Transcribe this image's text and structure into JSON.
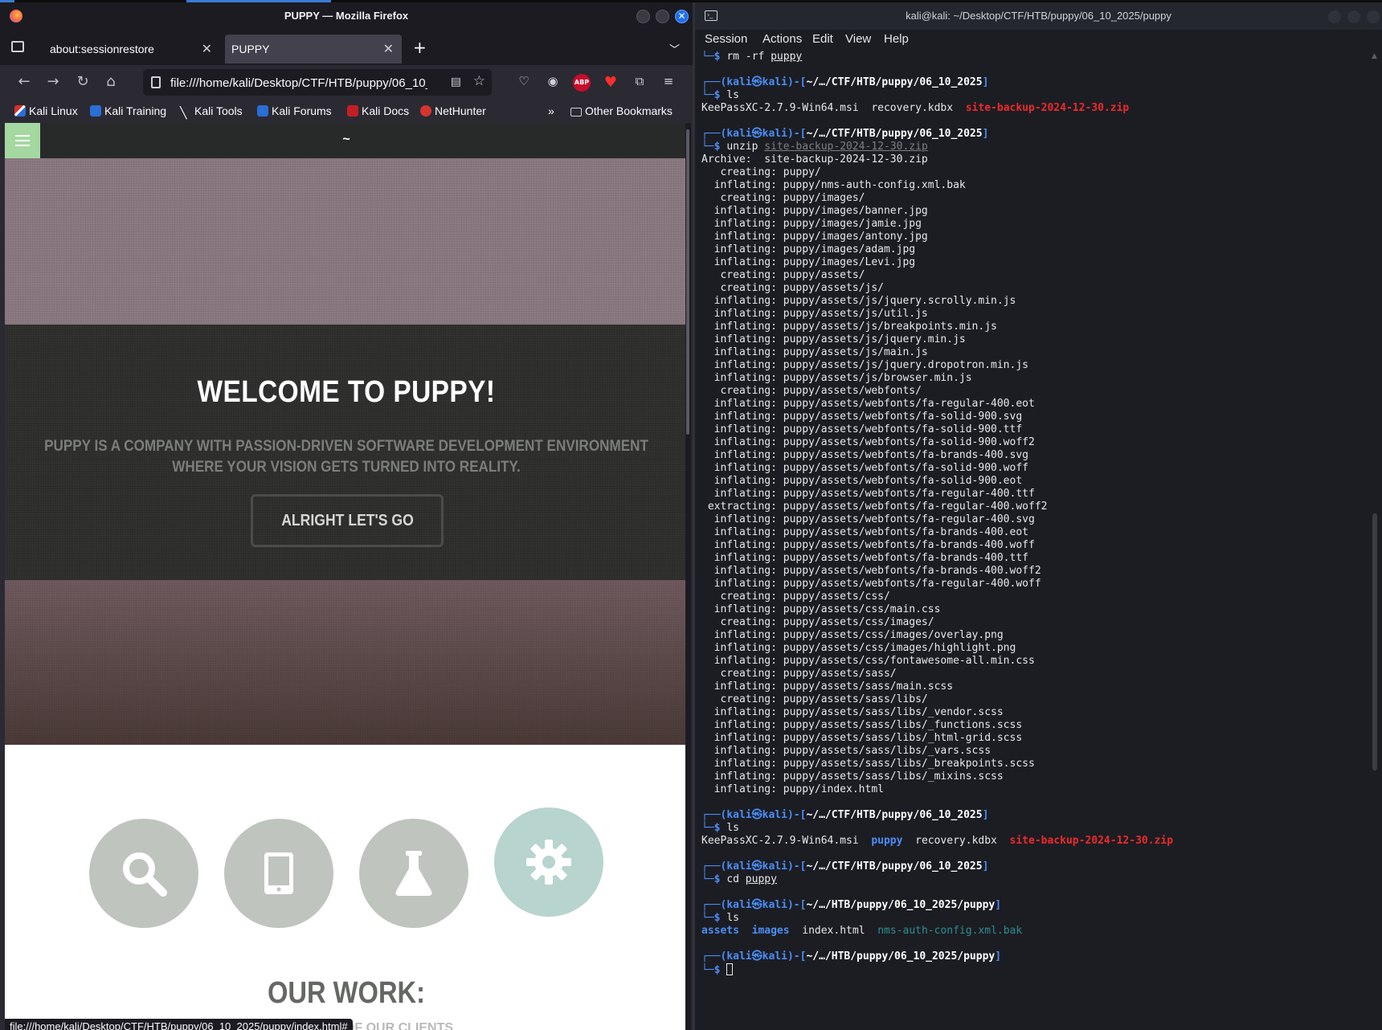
{
  "firefox": {
    "window_title": "PUPPY — Mozilla Firefox",
    "tabs": [
      {
        "label": "about:sessionrestore",
        "active": false
      },
      {
        "label": "PUPPY",
        "active": true
      }
    ],
    "url": "file:///home/kali/Desktop/CTF/HTB/puppy/06_10_2025/puppy/index.html",
    "bookmarks": [
      "Kali Linux",
      "Kali Training",
      "Kali Tools",
      "Kali Forums",
      "Kali Docs",
      "NetHunter"
    ],
    "other_bookmarks": "Other Bookmarks",
    "status_url": "file:///home/kali/Desktop/CTF/HTB/puppy/06_10_2025/puppy/index.html#"
  },
  "page": {
    "header_text": "~",
    "welcome": "WELCOME TO PUPPY!",
    "tagline": "PUPPY IS A COMPANY WITH PASSION-DRIVEN SOFTWARE DEVELOPMENT ENVIRONMENT WHERE YOUR VISION GETS TURNED INTO REALITY.",
    "cta": "ALRIGHT LET'S GO",
    "feature_icons": [
      "search-icon",
      "tablet-icon",
      "flask-icon",
      "gear-icon"
    ],
    "our_work": "OUR WORK:",
    "work_sub": "ID AND BUDGET OF OUR CLIENTS"
  },
  "terminal": {
    "window_title": "kali@kali: ~/Desktop/CTF/HTB/puppy/06_10_2025/puppy",
    "menu": [
      "Session",
      "Actions",
      "Edit",
      "View",
      "Help"
    ],
    "prompt": {
      "user": "kali",
      "at": "㉿",
      "host": "kali",
      "path1": "~/…/CTF/HTB/puppy/06_10_2025",
      "path2": "~/…/HTB/puppy/06_10_2025/puppy"
    },
    "cmd_rm": "rm -rf",
    "cmd_rm_arg": "puppy",
    "cmd_ls": "ls",
    "cmd_unzip": "unzip",
    "cmd_cd": "cd",
    "zip_name": "site-backup-2024-12-30.zip",
    "ls1": {
      "f1": "KeePassXC-2.7.9-Win64.msi",
      "f2": "recovery.kdbx",
      "f3": "site-backup-2024-12-30.zip"
    },
    "ls2": {
      "f1": "KeePassXC-2.7.9-Win64.msi",
      "d1": "puppy",
      "f2": "recovery.kdbx",
      "f3": "site-backup-2024-12-30.zip"
    },
    "ls3": {
      "d1": "assets",
      "d2": "images",
      "f1": "index.html",
      "f2": "nms-auth-config.xml.bak"
    },
    "cd_arg": "puppy",
    "unzip_output": [
      "Archive:  site-backup-2024-12-30.zip",
      "   creating: puppy/",
      "  inflating: puppy/nms-auth-config.xml.bak",
      "   creating: puppy/images/",
      "  inflating: puppy/images/banner.jpg",
      "  inflating: puppy/images/jamie.jpg",
      "  inflating: puppy/images/antony.jpg",
      "  inflating: puppy/images/adam.jpg",
      "  inflating: puppy/images/Levi.jpg",
      "   creating: puppy/assets/",
      "   creating: puppy/assets/js/",
      "  inflating: puppy/assets/js/jquery.scrolly.min.js",
      "  inflating: puppy/assets/js/util.js",
      "  inflating: puppy/assets/js/breakpoints.min.js",
      "  inflating: puppy/assets/js/jquery.min.js",
      "  inflating: puppy/assets/js/main.js",
      "  inflating: puppy/assets/js/jquery.dropotron.min.js",
      "  inflating: puppy/assets/js/browser.min.js",
      "   creating: puppy/assets/webfonts/",
      "  inflating: puppy/assets/webfonts/fa-regular-400.eot",
      "  inflating: puppy/assets/webfonts/fa-solid-900.svg",
      "  inflating: puppy/assets/webfonts/fa-solid-900.ttf",
      "  inflating: puppy/assets/webfonts/fa-solid-900.woff2",
      "  inflating: puppy/assets/webfonts/fa-brands-400.svg",
      "  inflating: puppy/assets/webfonts/fa-solid-900.woff",
      "  inflating: puppy/assets/webfonts/fa-solid-900.eot",
      "  inflating: puppy/assets/webfonts/fa-regular-400.ttf",
      " extracting: puppy/assets/webfonts/fa-regular-400.woff2",
      "  inflating: puppy/assets/webfonts/fa-regular-400.svg",
      "  inflating: puppy/assets/webfonts/fa-brands-400.eot",
      "  inflating: puppy/assets/webfonts/fa-brands-400.woff",
      "  inflating: puppy/assets/webfonts/fa-brands-400.ttf",
      "  inflating: puppy/assets/webfonts/fa-brands-400.woff2",
      "  inflating: puppy/assets/webfonts/fa-regular-400.woff",
      "   creating: puppy/assets/css/",
      "  inflating: puppy/assets/css/main.css",
      "   creating: puppy/assets/css/images/",
      "  inflating: puppy/assets/css/images/overlay.png",
      "  inflating: puppy/assets/css/images/highlight.png",
      "  inflating: puppy/assets/css/fontawesome-all.min.css",
      "   creating: puppy/assets/sass/",
      "  inflating: puppy/assets/sass/main.scss",
      "   creating: puppy/assets/sass/libs/",
      "  inflating: puppy/assets/sass/libs/_vendor.scss",
      "  inflating: puppy/assets/sass/libs/_functions.scss",
      "  inflating: puppy/assets/sass/libs/_html-grid.scss",
      "  inflating: puppy/assets/sass/libs/_vars.scss",
      "  inflating: puppy/assets/sass/libs/_breakpoints.scss",
      "  inflating: puppy/assets/sass/libs/_mixins.scss",
      "  inflating: puppy/index.html"
    ]
  },
  "colors": {
    "prompt_blue": "#4c8df6",
    "zip_red": "#ef2929",
    "bak_teal": "#2f8f8f",
    "accent_green": "#a4d8a0",
    "circle_grey": "#c0c4bf",
    "circle_teal": "#b7d4ce"
  }
}
